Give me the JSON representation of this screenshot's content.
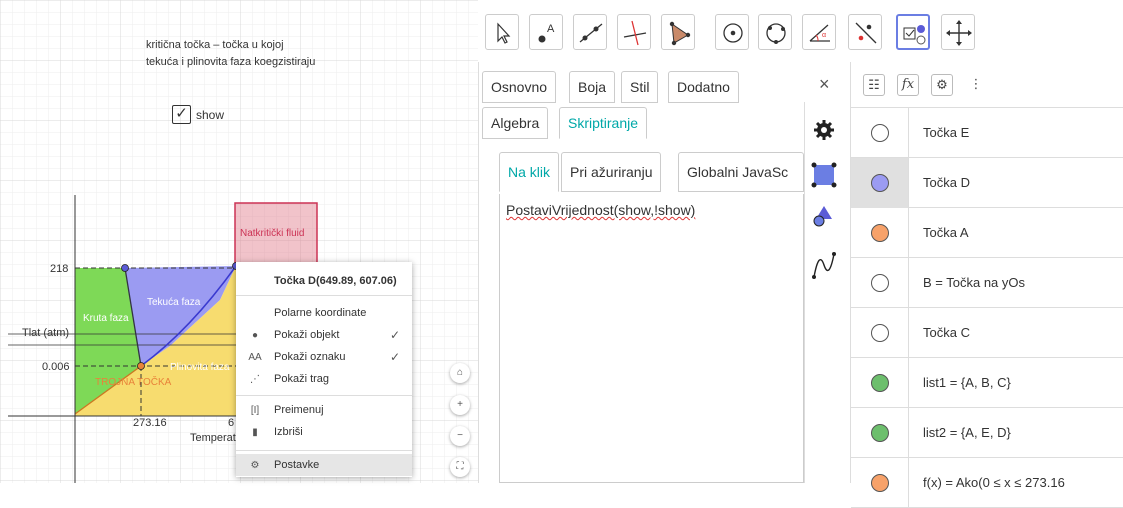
{
  "graphics": {
    "caption_line1": "kritična točka – točka u kojoj",
    "caption_line2": "tekuća i plinovita faza koegzistiraju",
    "checkbox_label": "show",
    "checkbox_checked": true,
    "y_tick_218": "218",
    "y_tick_0006": "0.006",
    "y_axis_label": "Tlat (atm)",
    "x_tick_27316": "273.16",
    "x_axis_label": "Temperat",
    "x_tick_partial": "6",
    "label_supercritical": "Natkritički fluid",
    "label_liquid": "Tekuća faza",
    "label_solid": "Kruta faza",
    "label_gas": "Plinovita faza",
    "label_triple": "TROJNA TOČKA",
    "colors": {
      "solid": "#7ed957",
      "liquid": "#9b9bf2",
      "gas": "#f7dc6f",
      "supercritical": "#e07a8a",
      "point_D": "#5b5bd6",
      "point_A": "#e8833a"
    }
  },
  "context_menu": {
    "title": "Točka D(649.89, 607.06)",
    "items": [
      {
        "label": "Polarne koordinate",
        "icon": "",
        "checked": false
      },
      {
        "label": "Pokaži objekt",
        "icon": "show-object-icon",
        "checked": true
      },
      {
        "label": "Pokaži oznaku",
        "icon": "show-label-icon",
        "checked": true
      },
      {
        "label": "Pokaži trag",
        "icon": "trace-icon",
        "checked": false
      },
      {
        "label": "Preimenuj",
        "icon": "rename-icon",
        "checked": false
      },
      {
        "label": "Izbriši",
        "icon": "delete-icon",
        "checked": false
      },
      {
        "label": "Postavke",
        "icon": "gear-icon",
        "checked": false
      }
    ]
  },
  "toolbar": {
    "tools": [
      "move-tool",
      "point-tool",
      "line-tool",
      "perpendicular-tool",
      "polygon-tool",
      "circle-tool",
      "circle-three-points-tool",
      "angle-tool",
      "reflect-tool",
      "checkbox-tool",
      "move-view-tool"
    ]
  },
  "properties": {
    "tabs_row1": [
      "Osnovno",
      "Boja",
      "Stil",
      "Dodatno"
    ],
    "close": "×",
    "tabs_row2": [
      "Algebra",
      "Skriptiranje"
    ],
    "script_tabs": [
      "Na klik",
      "Pri ažuriranju",
      "Globalni JavaSc"
    ],
    "script_text": "PostaviVrijednost(show,!show)"
  },
  "algebra": {
    "rows": [
      {
        "text": "Točka E",
        "color": "#ffffff",
        "selected": false
      },
      {
        "text": "Točka D",
        "color": "#9b9bf2",
        "selected": true
      },
      {
        "text": "Točka A",
        "color": "#f7a26a",
        "selected": false
      },
      {
        "text": "B = Točka na yOs",
        "color": "#ffffff",
        "selected": false
      },
      {
        "text": "Točka C",
        "color": "#ffffff",
        "selected": false
      },
      {
        "text": "list1 = {A, B, C}",
        "color": "#6dbf6d",
        "selected": false
      },
      {
        "text": "list2 = {A, E, D}",
        "color": "#6dbf6d",
        "selected": false
      },
      {
        "text": "f(x) = Ako(0 ≤ x ≤ 273.16",
        "color": "#f7a26a",
        "selected": false
      }
    ]
  }
}
